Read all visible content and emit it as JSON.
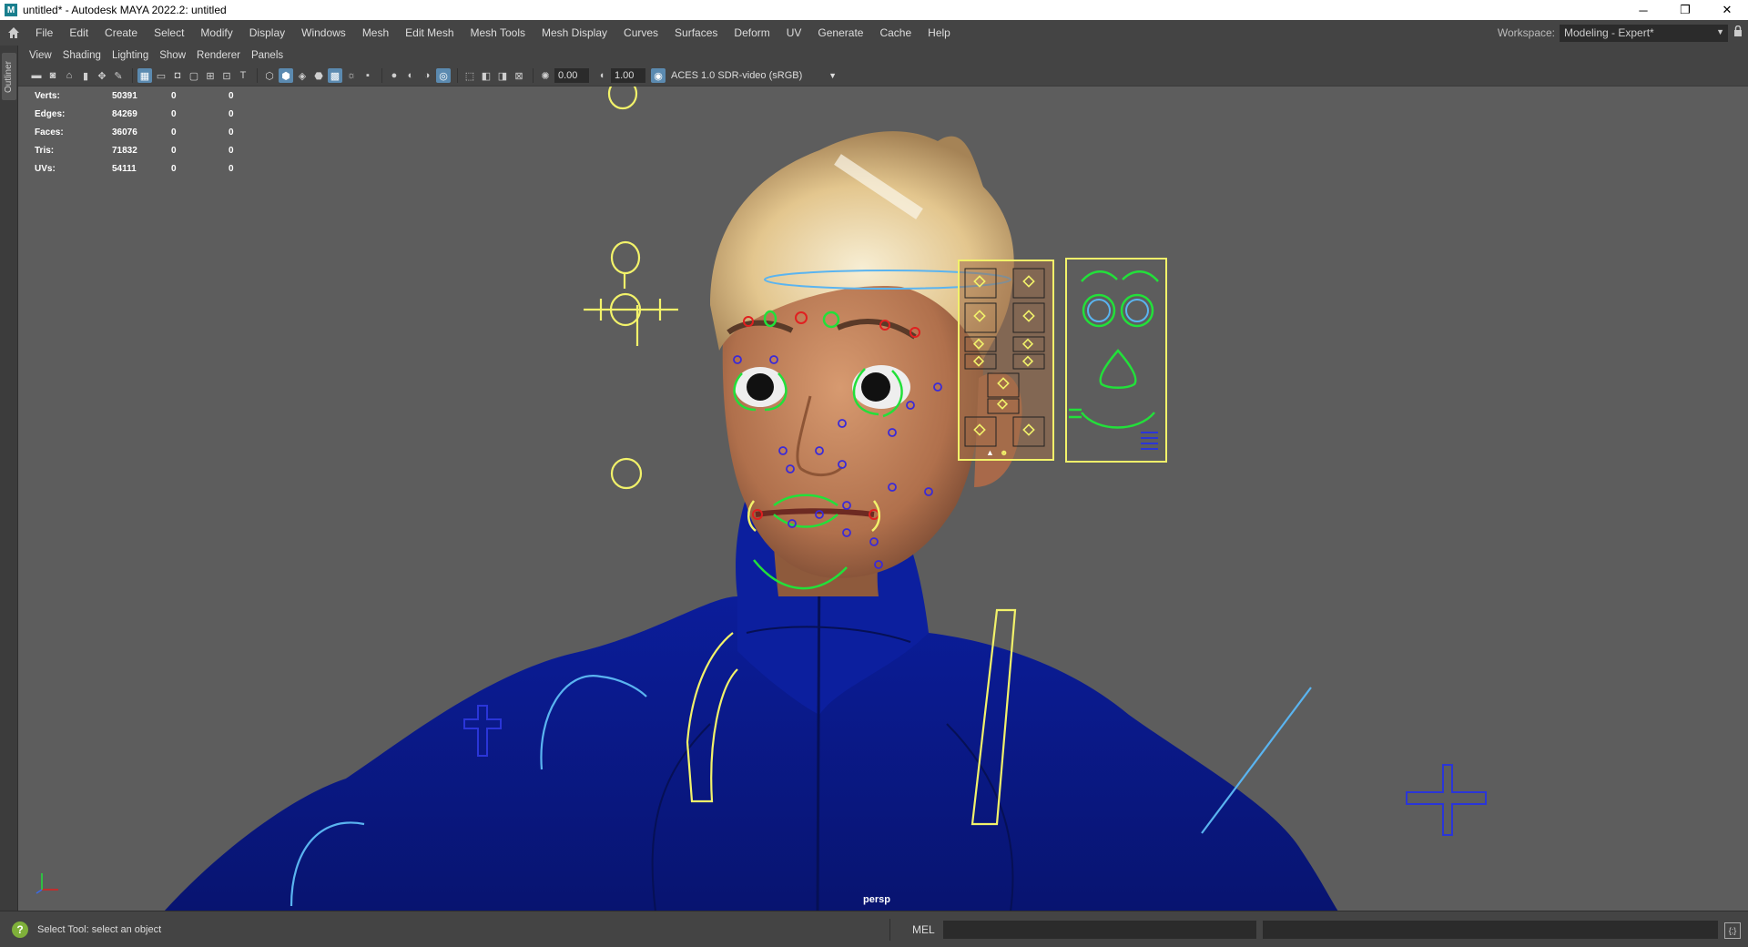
{
  "window": {
    "title": "untitled* - Autodesk MAYA 2022.2: untitled",
    "app_icon": "M",
    "minimize": "─",
    "restore": "❐",
    "close": "✕"
  },
  "menubar": {
    "items": [
      "File",
      "Edit",
      "Create",
      "Select",
      "Modify",
      "Display",
      "Windows",
      "Mesh",
      "Edit Mesh",
      "Mesh Tools",
      "Mesh Display",
      "Curves",
      "Surfaces",
      "Deform",
      "UV",
      "Generate",
      "Cache",
      "Help"
    ],
    "workspace_label": "Workspace:",
    "workspace_value": "Modeling - Expert*"
  },
  "outliner": {
    "label": "Outliner"
  },
  "panel_menu": {
    "items": [
      "View",
      "Shading",
      "Lighting",
      "Show",
      "Renderer",
      "Panels"
    ]
  },
  "panel_toolbar": {
    "exposure": "0.00",
    "gamma": "1.00",
    "color_space": "ACES 1.0 SDR-video (sRGB)"
  },
  "hud": {
    "rows": [
      {
        "label": "Verts:",
        "v1": "50391",
        "v2": "0",
        "v3": "0"
      },
      {
        "label": "Edges:",
        "v1": "84269",
        "v2": "0",
        "v3": "0"
      },
      {
        "label": "Faces:",
        "v1": "36076",
        "v2": "0",
        "v3": "0"
      },
      {
        "label": "Tris:",
        "v1": "71832",
        "v2": "0",
        "v3": "0"
      },
      {
        "label": "UVs:",
        "v1": "54111",
        "v2": "0",
        "v3": "0"
      }
    ]
  },
  "viewport": {
    "camera": "persp"
  },
  "status": {
    "help_text": "Select Tool: select an object",
    "mel_label": "MEL"
  },
  "colors": {
    "viewport_bg": "#5d5d5d",
    "jacket": "#0a1a8a",
    "skin": "#c68a60",
    "hair": "#e8cf9a",
    "yellow_ctrl": "#f2f26a",
    "green_ctrl": "#22e03a",
    "blue_ctrl": "#5ab4f0",
    "navy_ctrl": "#2a35d8"
  }
}
